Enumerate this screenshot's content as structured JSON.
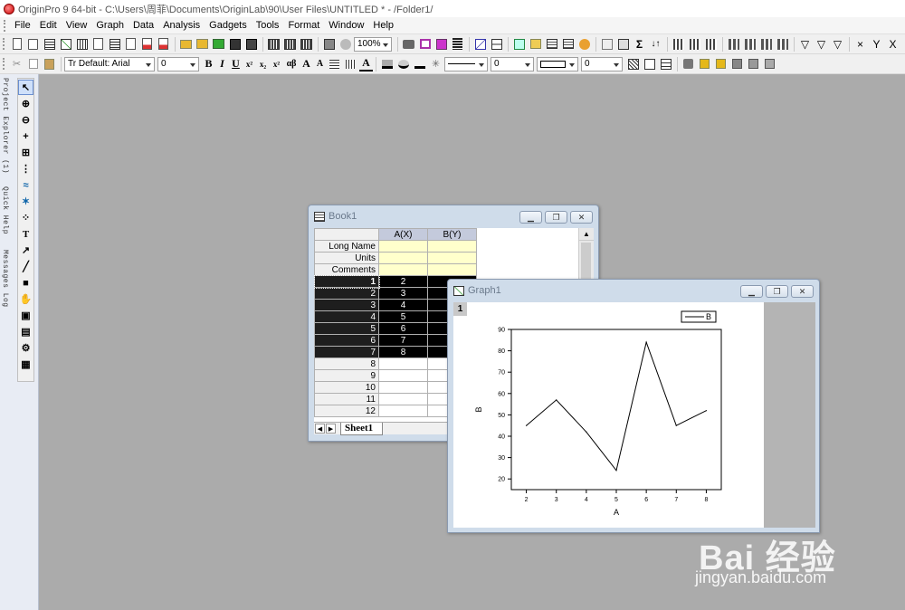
{
  "titlebar": {
    "title": "OriginPro 9 64-bit - C:\\Users\\周菲\\Documents\\OriginLab\\90\\User Files\\UNTITLED * - /Folder1/"
  },
  "menu": [
    "File",
    "Edit",
    "View",
    "Graph",
    "Data",
    "Analysis",
    "Gadgets",
    "Tools",
    "Format",
    "Window",
    "Help"
  ],
  "toolbar1": {
    "zoom": "100%"
  },
  "toolbar2": {
    "font": "Tr Default: Arial",
    "font_size": "0",
    "line_width": "0",
    "border_width": "0"
  },
  "side_tabs": [
    "Project Explorer (1)",
    "Quick Help",
    "Messages Log"
  ],
  "book": {
    "title": "Book1",
    "columns": [
      "A(X)",
      "B(Y)"
    ],
    "meta_rows": [
      "Long Name",
      "Units",
      "Comments"
    ],
    "rows": [
      {
        "n": "1",
        "a": "2",
        "b": ""
      },
      {
        "n": "2",
        "a": "3",
        "b": ""
      },
      {
        "n": "3",
        "a": "4",
        "b": ""
      },
      {
        "n": "4",
        "a": "5",
        "b": ""
      },
      {
        "n": "5",
        "a": "6",
        "b": ""
      },
      {
        "n": "6",
        "a": "7",
        "b": ""
      },
      {
        "n": "7",
        "a": "8",
        "b": ""
      },
      {
        "n": "8",
        "a": "",
        "b": ""
      },
      {
        "n": "9",
        "a": "",
        "b": ""
      },
      {
        "n": "10",
        "a": "",
        "b": ""
      },
      {
        "n": "11",
        "a": "",
        "b": ""
      },
      {
        "n": "12",
        "a": "",
        "b": ""
      }
    ],
    "sheet_tab": "Sheet1"
  },
  "graph": {
    "title": "Graph1",
    "layer": "1"
  },
  "chart_data": {
    "type": "line",
    "x": [
      2,
      3,
      4,
      5,
      6,
      7,
      8
    ],
    "series": [
      {
        "name": "B",
        "values": [
          45,
          57,
          42,
          24,
          84,
          45,
          52
        ]
      }
    ],
    "xlabel": "A",
    "ylabel": "B",
    "xlim": [
      1.5,
      8.5
    ],
    "ylim": [
      15,
      90
    ],
    "xticks": [
      2,
      3,
      4,
      5,
      6,
      7,
      8
    ],
    "yticks": [
      20,
      30,
      40,
      50,
      60,
      70,
      80,
      90
    ],
    "legend": "top-right",
    "grid": false,
    "line_color": "#000000"
  },
  "watermark": {
    "logo": "Bai 经验",
    "url": "jingyan.baidu.com"
  }
}
